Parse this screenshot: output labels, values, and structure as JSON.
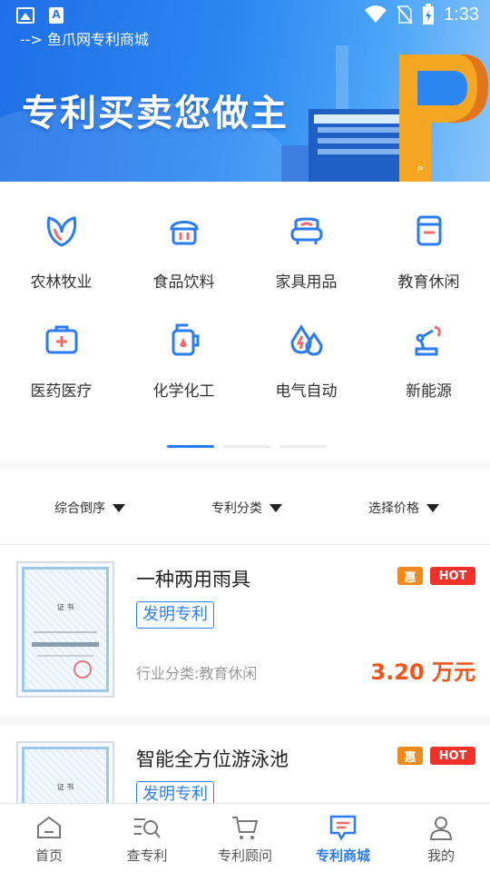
{
  "status_bar": {
    "time": "1:33",
    "icons": [
      "image-icon",
      "a-icon",
      "wifi-icon",
      "no-sim-icon",
      "battery-icon"
    ]
  },
  "banner": {
    "link_text": "--> 鱼爪网专利商城",
    "slogan": "专利买卖您做主",
    "art_letter": "P"
  },
  "categories": [
    {
      "label": "农林牧业",
      "icon": "leaf-icon"
    },
    {
      "label": "食品饮料",
      "icon": "cupcake-icon"
    },
    {
      "label": "家具用品",
      "icon": "armchair-icon"
    },
    {
      "label": "教育休闲",
      "icon": "book-icon"
    },
    {
      "label": "医药医疗",
      "icon": "medical-kit-icon"
    },
    {
      "label": "化学化工",
      "icon": "chemical-bottle-icon"
    },
    {
      "label": "电气自动",
      "icon": "electric-drop-icon"
    },
    {
      "label": "新能源",
      "icon": "robot-arm-icon"
    }
  ],
  "filters": [
    {
      "label": "综合倒序"
    },
    {
      "label": "专利分类"
    },
    {
      "label": "选择价格"
    }
  ],
  "products": [
    {
      "title": "一种两用雨具",
      "badge_discount": "惠",
      "badge_hot": "HOT",
      "type": "发明专利",
      "industry": "行业分类:教育休闲",
      "price": "3.20 万元",
      "thumb": {
        "cert_title": "证 书"
      }
    },
    {
      "title": "智能全方位游泳池",
      "badge_discount": "惠",
      "badge_hot": "HOT",
      "type": "发明专利",
      "industry": "",
      "price": "",
      "thumb": {
        "cert_title": "证 书"
      }
    }
  ],
  "bottom_nav": [
    {
      "label": "首页",
      "icon": "home-icon",
      "active": false
    },
    {
      "label": "查专利",
      "icon": "search-list-icon",
      "active": false
    },
    {
      "label": "专利顾问",
      "icon": "cart-icon",
      "active": false
    },
    {
      "label": "专利商城",
      "icon": "message-icon",
      "active": true
    },
    {
      "label": "我的",
      "icon": "profile-icon",
      "active": false
    }
  ],
  "colors": {
    "accent": "#2a7cf0",
    "price": "#f2541b",
    "hot": "#f0322b",
    "discount": "#f08a1c",
    "icon_red": "#f26b6b"
  }
}
